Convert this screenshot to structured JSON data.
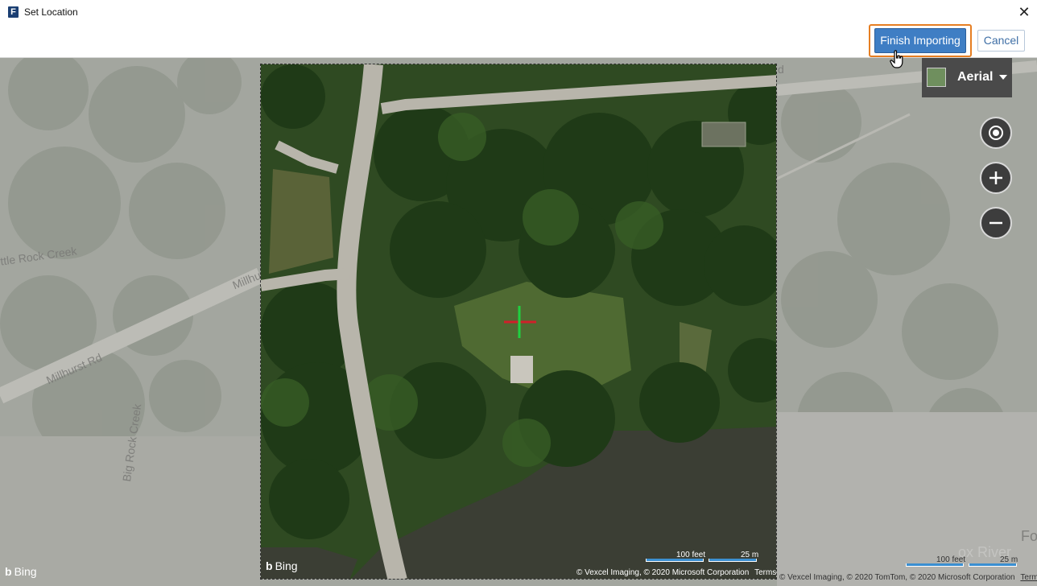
{
  "window": {
    "title": "Set Location",
    "app_icon_letter": "F",
    "close_glyph": "✕"
  },
  "toolbar": {
    "finish_label": "Finish Importing",
    "cancel_label": "Cancel"
  },
  "map": {
    "style_label": "Aerial",
    "road_labels": [
      "ttle Rock Creek",
      "Millhu",
      "Millhurst Rd",
      "Big Rock Creek",
      "Fo",
      "ox River",
      "d"
    ],
    "aerial_attribution": "© Vexcel Imaging, © 2020 Microsoft Corporation",
    "aerial_terms": "Terms",
    "outer_attribution": "© Vexcel Imaging, © 2020 TomTom, © 2020 Microsoft Corporation",
    "outer_terms": "Terms",
    "bing_label": "Bing",
    "scale_feet": "100 feet",
    "scale_m": "25 m",
    "buttons": [
      "locate-icon",
      "zoom-in-icon",
      "zoom-out-icon"
    ]
  },
  "colors": {
    "accent_ring": "#e67e22",
    "primary_button": "#3f7ec4",
    "crosshair_h": "#d0202a",
    "crosshair_v": "#1fd140"
  }
}
